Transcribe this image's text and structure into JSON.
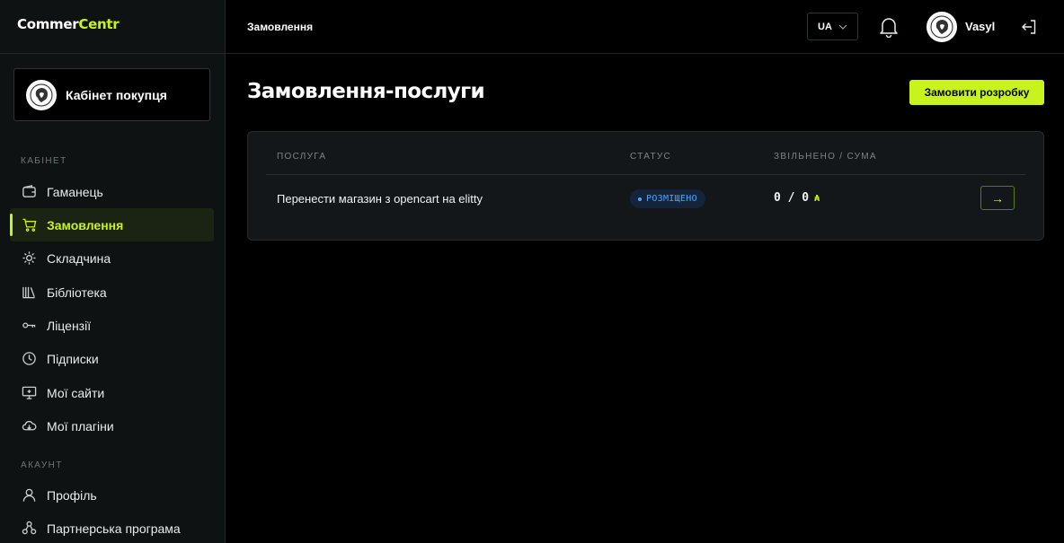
{
  "app": {
    "logo_part1": "Commer",
    "logo_part2": "Centr",
    "accent_color": "#c8f31d"
  },
  "sidebar": {
    "cabinet_label": "Кабінет покупця",
    "sections": [
      {
        "title": "КАБІНЕТ",
        "items": [
          {
            "label": "Гаманець",
            "icon": "wallet-icon",
            "active": false
          },
          {
            "label": "Замовлення",
            "icon": "cart-icon",
            "active": true
          },
          {
            "label": "Складчина",
            "icon": "sun-icon",
            "active": false
          },
          {
            "label": "Бібліотека",
            "icon": "library-icon",
            "active": false
          },
          {
            "label": "Ліцензії",
            "icon": "key-icon",
            "active": false
          },
          {
            "label": "Підписки",
            "icon": "clock-icon",
            "active": false
          },
          {
            "label": "Мої сайти",
            "icon": "monitor-icon",
            "active": false
          },
          {
            "label": "Мої плагіни",
            "icon": "cloud-icon",
            "active": false
          }
        ]
      },
      {
        "title": "АКАУНТ",
        "items": [
          {
            "label": "Профіль",
            "icon": "user-icon",
            "active": false
          },
          {
            "label": "Партнерська програма",
            "icon": "network-icon",
            "active": false
          }
        ]
      }
    ]
  },
  "topbar": {
    "breadcrumb": "Замовлення",
    "language": "UA",
    "username": "Vasyl"
  },
  "main": {
    "title": "Замовлення-послуги",
    "primary_button": "Замовити розробку",
    "table": {
      "headers": [
        "ПОСЛУГА",
        "СТАТУС",
        "ЗВІЛЬНЕНО / СУМА"
      ],
      "rows": [
        {
          "service": "Перенести магазин з opencart на elitty",
          "status": "РОЗМІЩЕНО",
          "amount": "0 / 0",
          "currency": "₳",
          "action": "→"
        }
      ]
    }
  }
}
